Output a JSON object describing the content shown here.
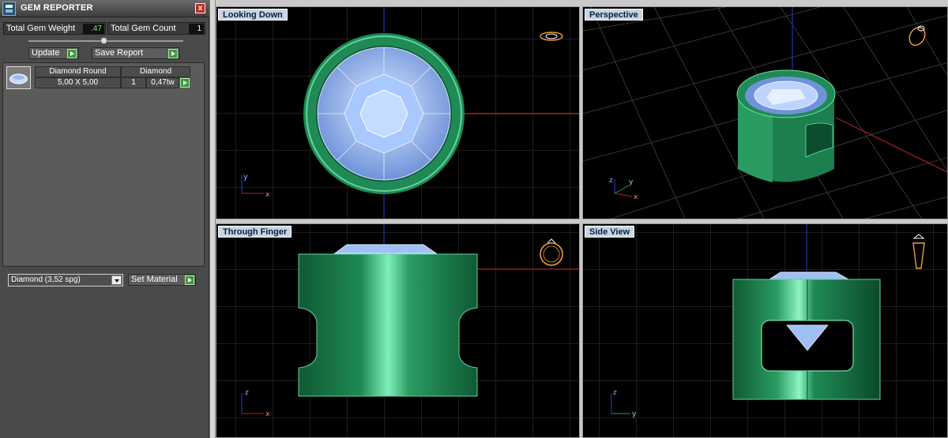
{
  "panel": {
    "title": "GEM REPORTER",
    "close_label": "x",
    "total_weight_label": "Total Gem Weight",
    "total_weight_value": ".47",
    "total_count_label": "Total Gem Count",
    "total_count_value": "1",
    "update_label": "Update",
    "save_report_label": "Save Report",
    "gem": {
      "name": "Diamond Round",
      "material": "Diamond",
      "size": "5,00 X 5,00",
      "count": "1",
      "weight": "0,47tw"
    },
    "material_select": "Diamond      (3,52 spg)",
    "set_material_label": "Set Material"
  },
  "viewports": [
    {
      "label": "Looking Down",
      "axis_a": "y",
      "axis_b": "x"
    },
    {
      "label": "Perspective",
      "axis_a": "z",
      "axis_b": "y",
      "axis_c": "x"
    },
    {
      "label": "Through Finger",
      "axis_a": "z",
      "axis_b": "x"
    },
    {
      "label": "Side View",
      "axis_a": "z",
      "axis_b": "y"
    }
  ],
  "colors": {
    "ring_green": "#1f8a55",
    "gem_blue": "#8ab0ec",
    "grid": "#2e2e2e",
    "axis_red": "#b01f1f",
    "axis_blue": "#2a3fc8",
    "label_bg": "#c8d4e3"
  }
}
